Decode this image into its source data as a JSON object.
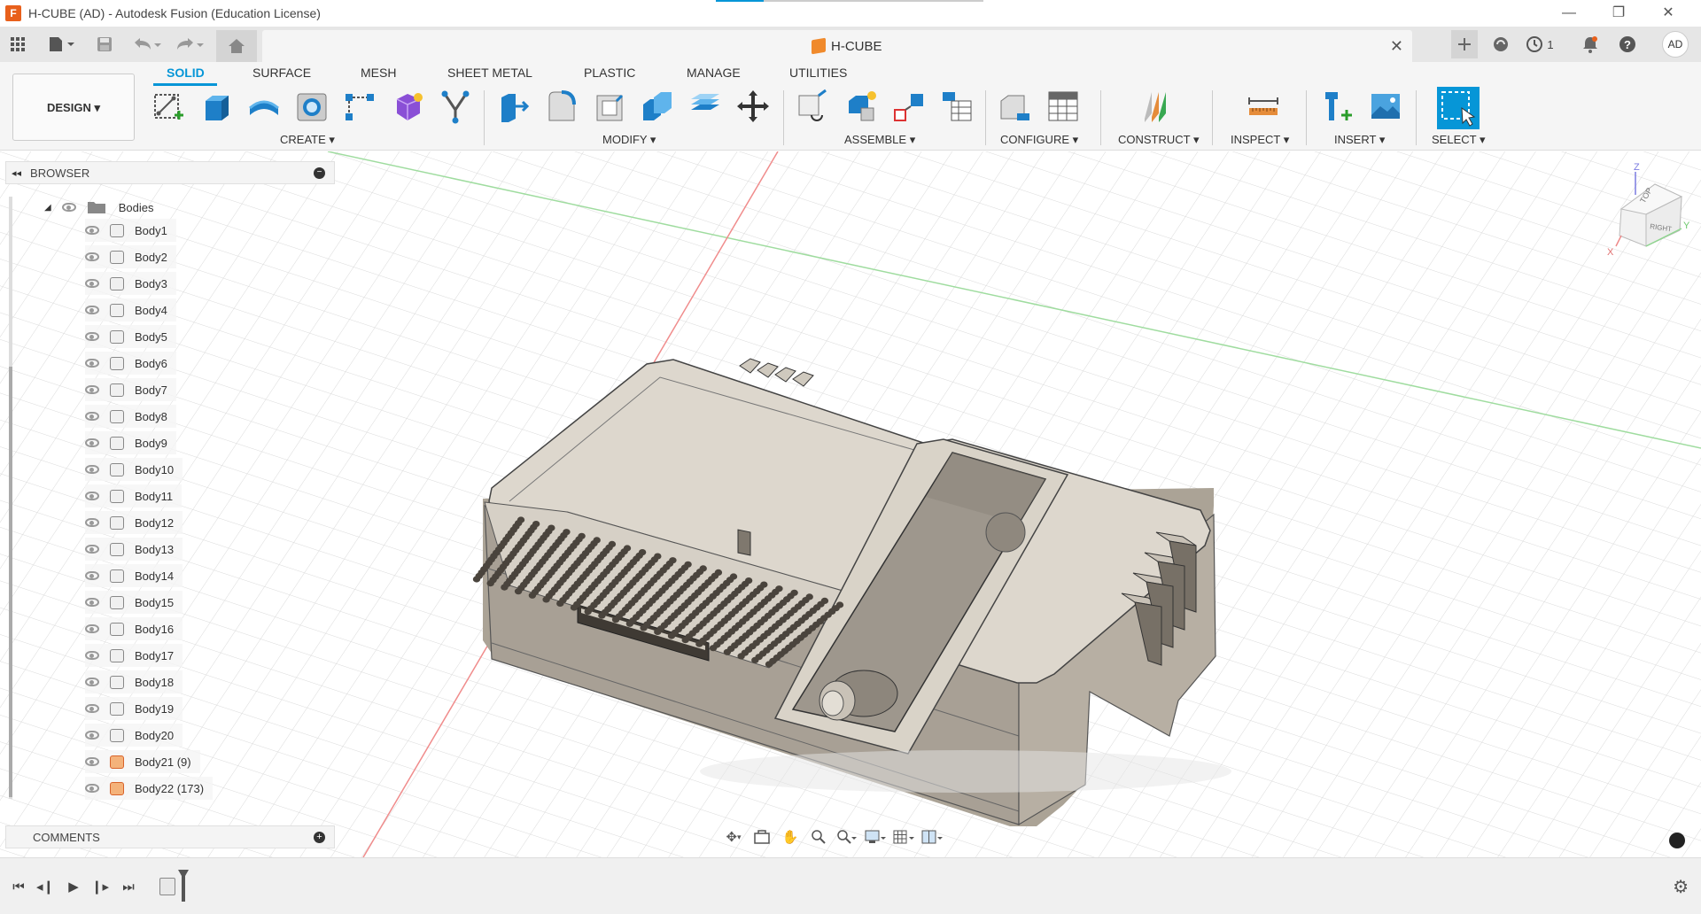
{
  "window": {
    "app_icon": "F",
    "title": "H-CUBE (AD) - Autodesk Fusion (Education License)",
    "progress": 0.18,
    "minimize": "—",
    "restore": "❐",
    "close": "✕"
  },
  "quickbar": {
    "grid_icon": "apps-grid-icon",
    "doc_title": "H-CUBE",
    "jobs_count": "1",
    "avatar": "AD"
  },
  "ribbon": {
    "workspace": "DESIGN ▾",
    "tabs": [
      "SOLID",
      "SURFACE",
      "MESH",
      "SHEET METAL",
      "PLASTIC",
      "MANAGE",
      "UTILITIES"
    ],
    "active_tab": "SOLID",
    "groups": {
      "create": "CREATE ▾",
      "modify": "MODIFY ▾",
      "assemble": "ASSEMBLE ▾",
      "configure": "CONFIGURE ▾",
      "construct": "CONSTRUCT ▾",
      "inspect": "INSPECT ▾",
      "insert": "INSERT ▾",
      "select": "SELECT ▾"
    },
    "accent": "#0696d7"
  },
  "browser": {
    "title": "BROWSER",
    "folder": "Bodies",
    "bodies": [
      "Body1",
      "Body2",
      "Body3",
      "Body4",
      "Body5",
      "Body6",
      "Body7",
      "Body8",
      "Body9",
      "Body10",
      "Body11",
      "Body12",
      "Body13",
      "Body14",
      "Body15",
      "Body16",
      "Body17",
      "Body18",
      "Body19",
      "Body20",
      "Body21 (9)",
      "Body22 (173)"
    ]
  },
  "comments": {
    "title": "COMMENTS"
  },
  "viewcube": {
    "top": "TOP",
    "right": "RIGHT",
    "axis_z": "Z",
    "axis_y": "Y",
    "axis_x": "X"
  }
}
